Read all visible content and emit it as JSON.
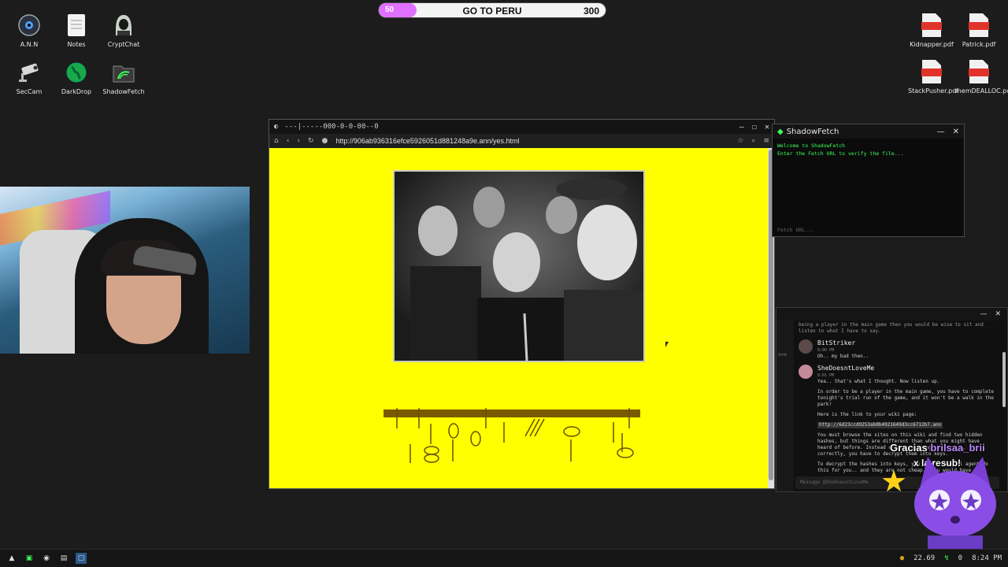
{
  "desktop": {
    "left_icons": [
      {
        "label": "A.N.N",
        "icon": "alien-eye-icon"
      },
      {
        "label": "Notes",
        "icon": "notes-icon"
      },
      {
        "label": "CryptChat",
        "icon": "hacker-hood-icon"
      },
      {
        "label": "SecCam",
        "icon": "security-camera-icon"
      },
      {
        "label": "DarkDrop",
        "icon": "globe-icon"
      },
      {
        "label": "ShadowFetch",
        "icon": "shadowfetch-icon"
      }
    ],
    "right_icons": [
      {
        "label": "Kidnapper.pdf",
        "icon": "pdf-icon",
        "badge": "PDF"
      },
      {
        "label": "Patrick.pdf",
        "icon": "pdf-icon",
        "badge": "PDF"
      },
      {
        "label": "StackPusher.pdf",
        "icon": "pdf-icon",
        "badge": "PDF"
      },
      {
        "label": "memDEALLOC.pdf",
        "icon": "pdf-icon",
        "badge": "PDF"
      }
    ]
  },
  "goal_bar": {
    "current": "50",
    "title": "GO TO PERU",
    "target": "300",
    "progress": 0.1667,
    "fill_color": "#e070ff"
  },
  "browser": {
    "title": "---|-----000-0-0-00--0",
    "url": "http://906ab936316efce5926051d881248a9e.ann/yes.html",
    "page_bg": "#ffff00"
  },
  "shadowfetch": {
    "title": "ShadowFetch",
    "lines": [
      "Welcome to ShadowFetch",
      "Enter the Fetch URL to verify the file..."
    ],
    "placeholder": "Fetch URL...",
    "text_color": "#3dff5a"
  },
  "chat": {
    "side_label": "ove",
    "top_line": "being a player in the main game then you would be wise to sit and listen to what I have to say.",
    "messages": [
      {
        "name": "BitStriker",
        "time": "8:00 PM",
        "lines": [
          "Oh.. my bad then.."
        ]
      },
      {
        "name": "SheDoesntLoveMe",
        "time": "8:01 PM",
        "lines": [
          "Yea.. that's what I thought. Now listen up.",
          "In order to be a player in the main game, you have to complete tonight's trial run of the game, and it won't be a walk in the park!",
          "Here is the link to your wiki page:",
          "You must browse the sites on this wiki and find two hidden hashes, but things are different than what you might have heard of before. Instead of just finding the hashes, correctly, you have to decrypt them into keys.",
          "To decrypt the hashes into keys, you need a special agent do this for you.. and they are not cheap.. you would have to"
        ],
        "link": "http://6d23ccd9253ab0b4921649d3cc6712b7.ann"
      }
    ],
    "input_placeholder": "Message @SheDoesntLoveMe"
  },
  "overlay": {
    "line1_prefix": "Gracias",
    "line1_name": "brilsaa_brii",
    "line2": "x la resub!"
  },
  "taskbar": {
    "tray_coins": "22.69",
    "tray_signal": "0",
    "clock": "8:24 PM"
  }
}
